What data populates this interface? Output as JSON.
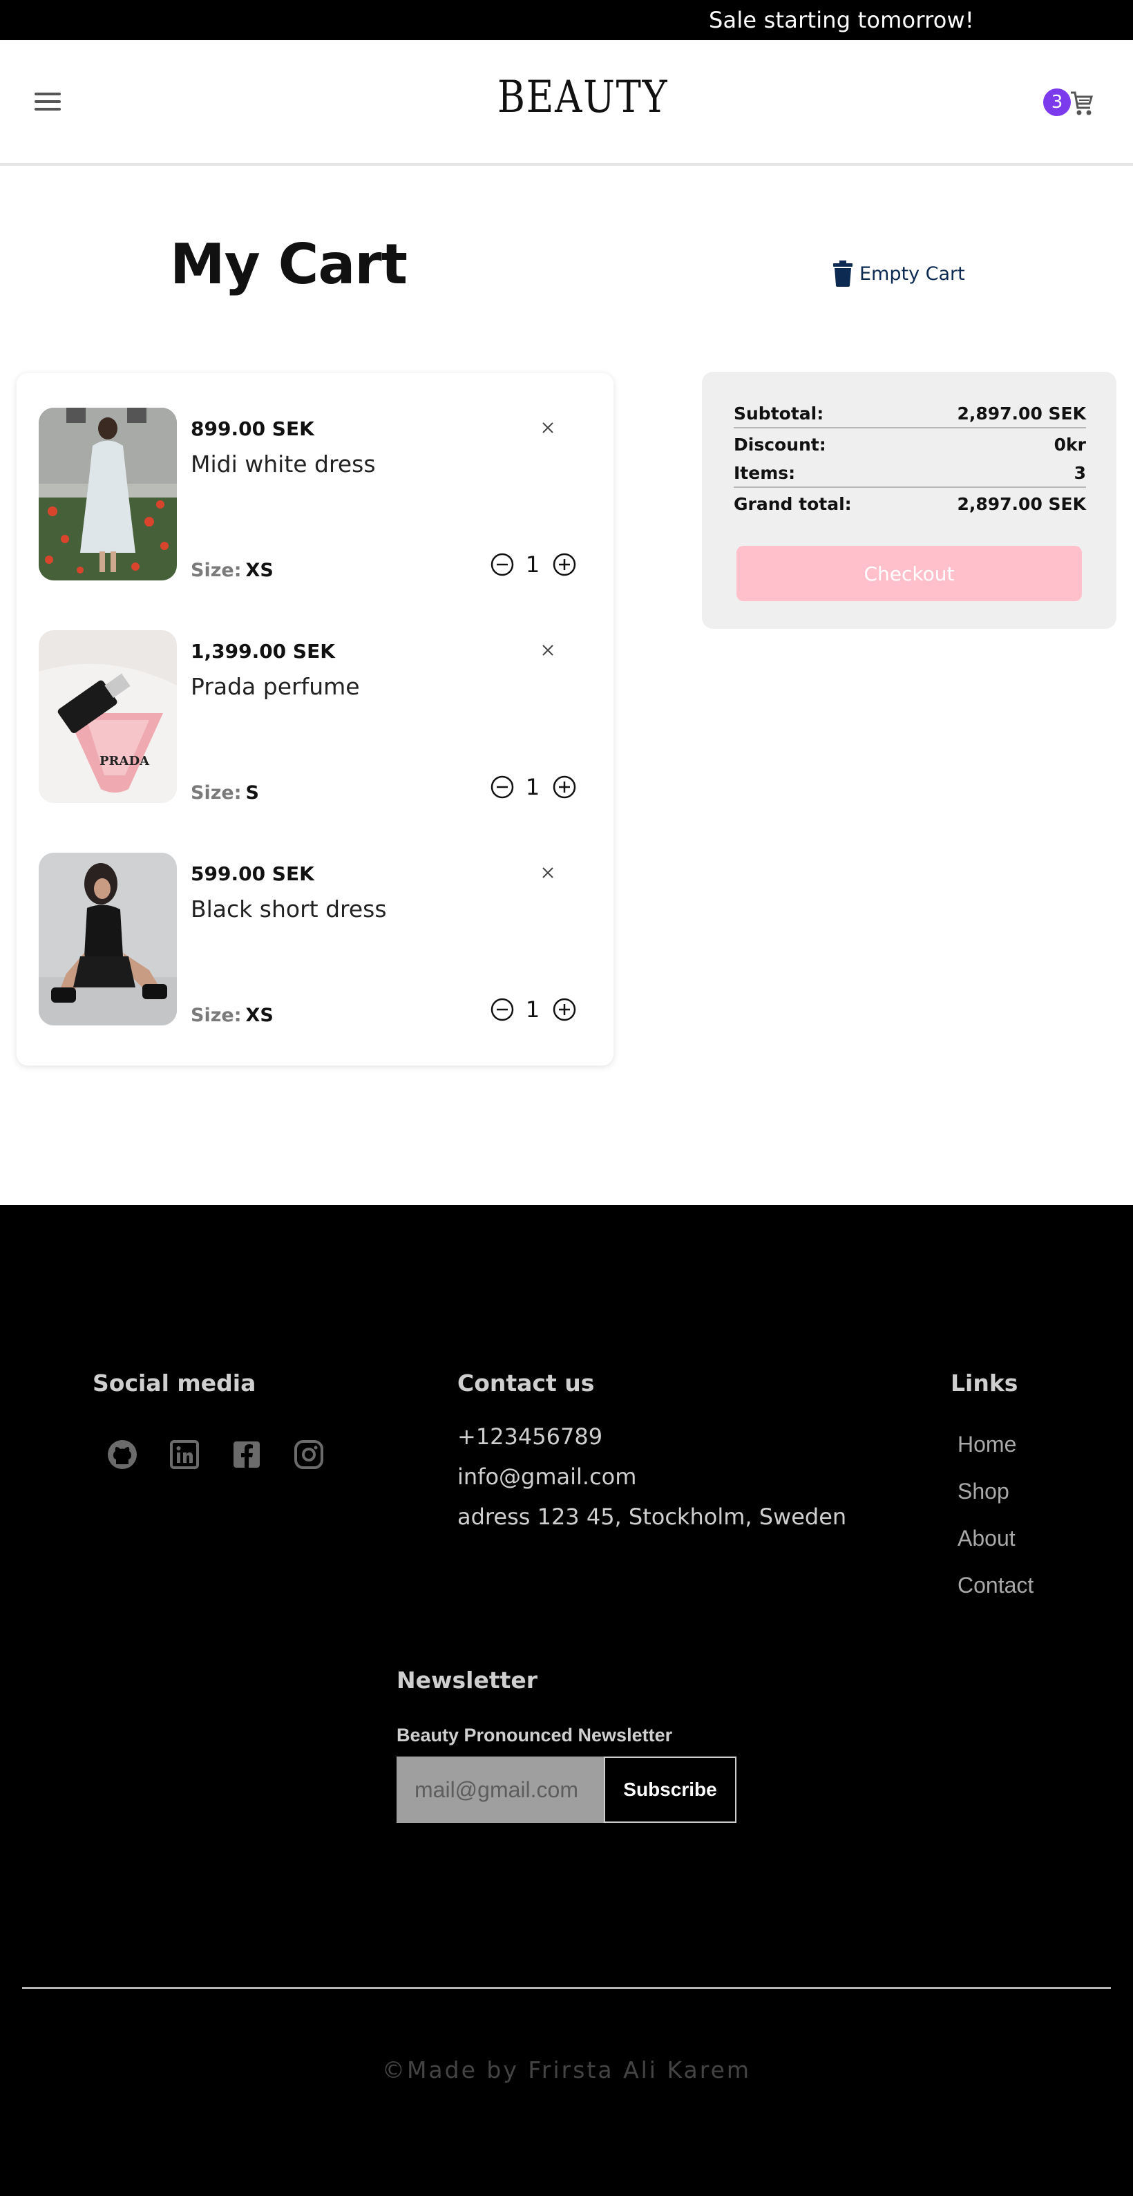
{
  "banner": {
    "text": "Sale starting tomorrow!"
  },
  "header": {
    "logo": "BEAUTY",
    "cart_count": "3"
  },
  "page": {
    "title": "My Cart",
    "empty_cart_label": "Empty Cart"
  },
  "cart": {
    "items": [
      {
        "price": "899.00 SEK",
        "name": "Midi white dress",
        "size_label": "Size:",
        "size": "XS",
        "quantity": "1",
        "image": "woman-in-white-dress-in-flower-field"
      },
      {
        "price": "1,399.00 SEK",
        "name": "Prada perfume",
        "size_label": "Size:",
        "size": "S",
        "quantity": "1",
        "image": "pink-prada-perfume-bottle",
        "image_text": "PRADA"
      },
      {
        "price": "599.00 SEK",
        "name": "Black short dress",
        "size_label": "Size:",
        "size": "XS",
        "quantity": "1",
        "image": "woman-in-black-short-dress"
      }
    ]
  },
  "summary": {
    "subtotal_label": "Subtotal:",
    "subtotal": "2,897.00 SEK",
    "discount_label": "Discount:",
    "discount": "0kr",
    "items_label": "Items:",
    "items": "3",
    "grand_total_label": "Grand total:",
    "grand_total": "2,897.00 SEK",
    "checkout_label": "Checkout"
  },
  "footer": {
    "social_heading": "Social media",
    "social_icons": [
      "github-icon",
      "linkedin-icon",
      "facebook-icon",
      "instagram-icon"
    ],
    "contact_heading": "Contact us",
    "phone": "+123456789",
    "email": "info@gmail.com",
    "address": "adress 123 45, Stockholm, Sweden",
    "links_heading": "Links",
    "links": [
      "Home",
      "Shop",
      "About",
      "Contact"
    ],
    "newsletter_heading": "Newsletter",
    "newsletter_label": "Beauty Pronounced Newsletter",
    "newsletter_placeholder": "mail@gmail.com",
    "subscribe_label": "Subscribe",
    "copyright": "©Made by Frirsta Ali Karem"
  },
  "colors": {
    "banner_bg": "#000000",
    "badge": "#7c3aed",
    "checkout_bg": "#ffc0cb",
    "summary_bg": "#efefef",
    "empty_cart": "#0d2a52",
    "footer_bg": "#000000"
  }
}
